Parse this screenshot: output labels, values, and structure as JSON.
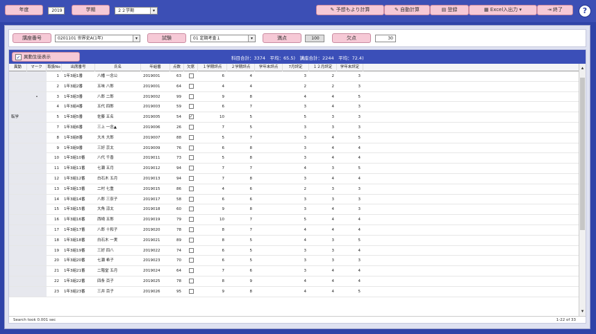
{
  "toolbar": {
    "year_label": "年度",
    "year_value": "2019",
    "term_label": "学期",
    "term_value": "２２学期",
    "calc_btn": "予想もより計算",
    "auto_calc": "自動計算",
    "register": "登録",
    "excel": "Excel入出力",
    "exit": "終了",
    "help": "?"
  },
  "filter": {
    "course_label": "講座番号",
    "course_value": "0201101 世界史A(1年)",
    "exam_label": "試験",
    "exam_value": "01 定期考査１",
    "full_label": "満点",
    "full_value": "100",
    "absent_label": "欠点",
    "absent_value": "30"
  },
  "grid": {
    "checkbox_label": "異動生徒表示",
    "checked": "✓",
    "summary": "科目合計：3374　平均：65.5)　講座合計：2244　平均：72.4)",
    "headers": [
      "異動",
      "マーク",
      "取扱No",
      "出席番号",
      "氏名",
      "年組番",
      "点数",
      "欠席",
      "１学期評点",
      "２学期評点",
      "学年末評点",
      "7月評定",
      "１２月評定",
      "学年末評定"
    ],
    "rows": [
      [
        "",
        "",
        "1",
        "1年3組1番",
        "八幡 一念公",
        "2019001",
        "63",
        "",
        "6",
        "4",
        "",
        "3",
        "2",
        "3"
      ],
      [
        "",
        "",
        "2",
        "1年3組2番",
        "五味 八郎",
        "2019001",
        "64",
        "",
        "4",
        "4",
        "",
        "2",
        "2",
        "3"
      ],
      [
        "",
        "•",
        "3",
        "1年3組3番",
        "八郎 二郎",
        "2019002",
        "99",
        "",
        "9",
        "8",
        "",
        "4",
        "4",
        "5"
      ],
      [
        "",
        "",
        "4",
        "1年3組4番",
        "五代 四郎",
        "2019003",
        "59",
        "",
        "6",
        "7",
        "",
        "3",
        "4",
        "3"
      ],
      [
        "転学",
        "",
        "5",
        "1年3組5番",
        "佐藤 五名",
        "2019005",
        "54",
        "✓",
        "10",
        "5",
        "",
        "5",
        "3",
        "3"
      ],
      [
        "",
        "",
        "7",
        "1年3組6番",
        "三上 一念▲",
        "2019006",
        "26",
        "",
        "7",
        "5",
        "",
        "3",
        "3",
        "3"
      ],
      [
        "",
        "",
        "8",
        "1年3組8番",
        "大木 大郎",
        "2019007",
        "88",
        "",
        "5",
        "7",
        "",
        "3",
        "4",
        "5"
      ],
      [
        "",
        "",
        "9",
        "1年3組9番",
        "三好 京太",
        "2019009",
        "76",
        "",
        "6",
        "8",
        "",
        "3",
        "4",
        "4"
      ],
      [
        "",
        "",
        "10",
        "1年3組10番",
        "八代 千香",
        "2019011",
        "73",
        "",
        "5",
        "8",
        "",
        "3",
        "4",
        "4"
      ],
      [
        "",
        "",
        "11",
        "1年3組11番",
        "七瀬 五月",
        "2019012",
        "94",
        "",
        "7",
        "7",
        "",
        "4",
        "3",
        "5"
      ],
      [
        "",
        "",
        "12",
        "1年3組12番",
        "白石木 五月",
        "2019013",
        "94",
        "",
        "7",
        "8",
        "",
        "3",
        "4",
        "4"
      ],
      [
        "",
        "",
        "13",
        "1年3組13番",
        "二村 七重",
        "2019015",
        "86",
        "",
        "4",
        "6",
        "",
        "2",
        "3",
        "3"
      ],
      [
        "",
        "",
        "14",
        "1年3組14番",
        "八郎 三奈子",
        "2019017",
        "58",
        "",
        "6",
        "6",
        "",
        "3",
        "3",
        "3"
      ],
      [
        "",
        "",
        "15",
        "1年3組15番",
        "大角 涼太",
        "2019018",
        "60",
        "",
        "9",
        "8",
        "",
        "3",
        "4",
        "3"
      ],
      [
        "",
        "",
        "16",
        "1年3組16番",
        "西崎 五郎",
        "2019019",
        "79",
        "",
        "10",
        "7",
        "",
        "5",
        "4",
        "4"
      ],
      [
        "",
        "",
        "17",
        "1年3組17番",
        "八郎 十和子",
        "2019020",
        "78",
        "",
        "8",
        "7",
        "",
        "4",
        "4",
        "4"
      ],
      [
        "",
        "",
        "18",
        "1年3組18番",
        "白石木 一実",
        "2019021",
        "89",
        "",
        "8",
        "5",
        "",
        "4",
        "3",
        "5"
      ],
      [
        "",
        "",
        "19",
        "1年3組19番",
        "三好 四八",
        "2019022",
        "74",
        "",
        "6",
        "5",
        "",
        "3",
        "3",
        "4"
      ],
      [
        "",
        "",
        "20",
        "1年3組20番",
        "七瀬 希子",
        "2019023",
        "70",
        "",
        "6",
        "5",
        "",
        "3",
        "3",
        "3"
      ],
      [
        "",
        "",
        "21",
        "1年3組21番",
        "二階堂 五月",
        "2019024",
        "64",
        "",
        "7",
        "6",
        "",
        "3",
        "4",
        "4"
      ],
      [
        "",
        "",
        "22",
        "1年3組22番",
        "四条 百子",
        "2019025",
        "78",
        "",
        "8",
        "9",
        "",
        "4",
        "4",
        "4"
      ],
      [
        "",
        "",
        "23",
        "1年3組23番",
        "三井 百子",
        "2019026",
        "95",
        "",
        "9",
        "8",
        "",
        "4",
        "4",
        "5"
      ]
    ],
    "footer_left": "Search took 0.001 sec",
    "footer_right": "1-22 of 33"
  }
}
